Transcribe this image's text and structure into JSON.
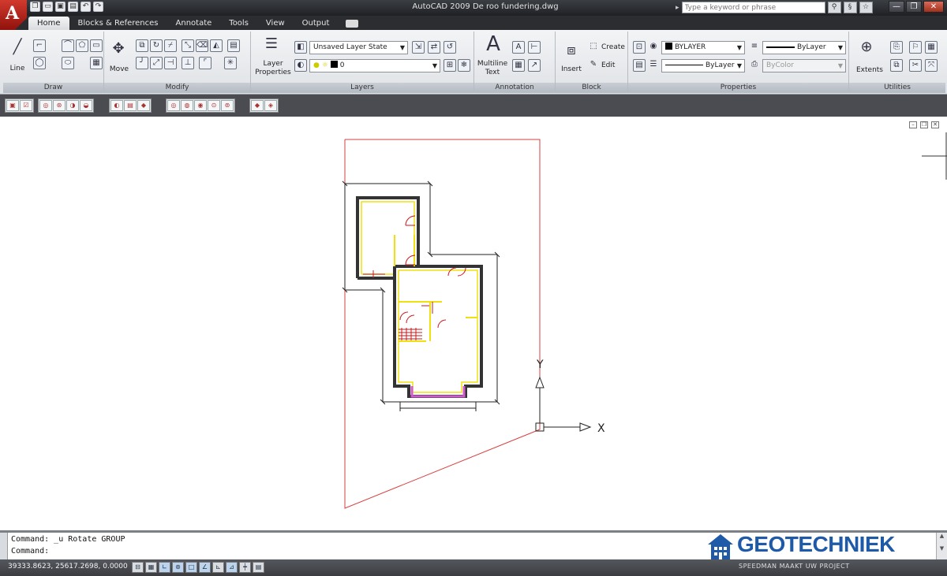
{
  "app": {
    "title": "AutoCAD 2009  De roo fundering.dwg",
    "logo_letter": "A",
    "search_placeholder": "Type a keyword or phrase",
    "win_minimize": "—",
    "win_restore": "❐",
    "win_close": "✕"
  },
  "qat": [
    "❐",
    "▭",
    "▣",
    "▤",
    "↶",
    "↷"
  ],
  "tabs": [
    {
      "label": "Home",
      "active": true
    },
    {
      "label": "Blocks & References",
      "active": false
    },
    {
      "label": "Annotate",
      "active": false
    },
    {
      "label": "Tools",
      "active": false
    },
    {
      "label": "View",
      "active": false
    },
    {
      "label": "Output",
      "active": false
    }
  ],
  "ribbon": {
    "draw": {
      "title": "Draw",
      "line_label": "Line"
    },
    "modify": {
      "title": "Modify",
      "move_label": "Move"
    },
    "layers": {
      "title": "Layers",
      "properties_label_1": "Layer",
      "properties_label_2": "Properties",
      "layer_state": "Unsaved Layer State",
      "current_layer": "0"
    },
    "annotation": {
      "title": "Annotation",
      "mtext_label_1": "Multiline",
      "mtext_label_2": "Text",
      "text_glyph": "A"
    },
    "block": {
      "title": "Block",
      "insert_label": "Insert",
      "create_label": "Create",
      "edit_label": "Edit"
    },
    "properties": {
      "title": "Properties",
      "color": "BYLAYER",
      "lineweight": "ByLayer",
      "linetype": "ByLayer",
      "plotstyle": "ByColor"
    },
    "utilities": {
      "title": "Utilities",
      "extents_label": "Extents"
    }
  },
  "drawing": {
    "ucs_x_label": "X",
    "ucs_y_label": "Y"
  },
  "command": {
    "line1": "Command: _u Rotate GROUP",
    "line2": "Command:"
  },
  "status": {
    "coords": "39333.8623, 25617.2698, 0.0000",
    "right_text": "SPEEDMAN  MAAKT UW PROJECT"
  },
  "watermark": {
    "text": "GEOTECHNIEK"
  },
  "colors": {
    "accent_red": "#c8171b",
    "plot_outline": "#d64040",
    "wall_yellow": "#f0e010",
    "bay_magenta": "#d05ad0",
    "brand_blue": "#1e5aa8"
  }
}
